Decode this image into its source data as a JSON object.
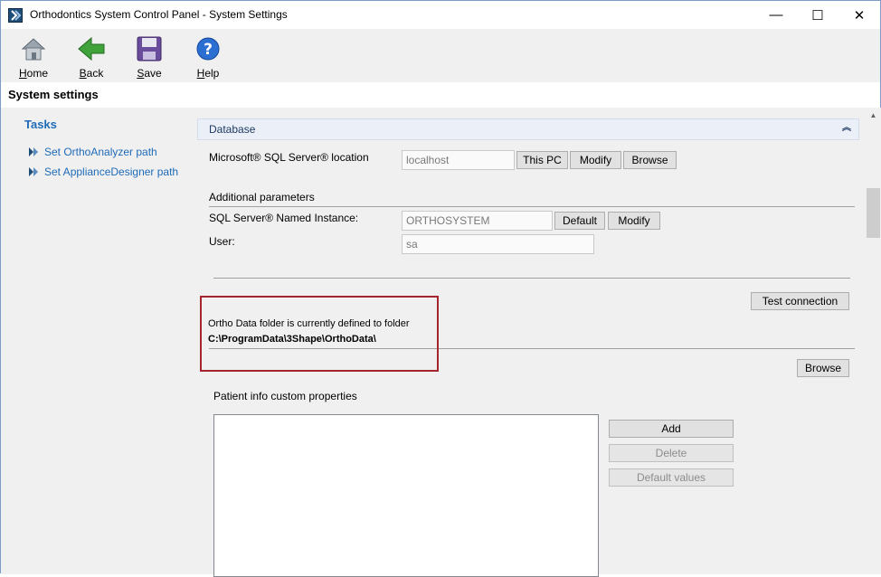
{
  "window": {
    "title": "Orthodontics System Control Panel - System Settings",
    "controls": {
      "minimize": "—",
      "maximize": "☐",
      "close": "✕"
    }
  },
  "toolbar": {
    "home": "Home",
    "back": "Back",
    "save": "Save",
    "help": "Help"
  },
  "page": {
    "title": "System settings"
  },
  "tasks": {
    "title": "Tasks",
    "items": [
      {
        "label": "Set OrthoAnalyzer path"
      },
      {
        "label": "Set ApplianceDesigner path"
      }
    ]
  },
  "database": {
    "section_title": "Database",
    "collapse_glyph": "︽",
    "sql_location_label": "Microsoft® SQL Server® location",
    "sql_location_value": "localhost",
    "this_pc": "This PC",
    "modify": "Modify",
    "browse": "Browse",
    "additional_params": "Additional parameters",
    "named_instance_label": "SQL Server® Named Instance:",
    "named_instance_value": "ORTHOSYSTEM",
    "default": "Default",
    "modify2": "Modify",
    "user_label": "User:",
    "user_value": "sa",
    "test_connection": "Test connection",
    "ortho_data_text": "Ortho Data folder is currently defined to folder",
    "ortho_data_path": "C:\\ProgramData\\3Shape\\OrthoData\\",
    "browse2": "Browse",
    "patient_info_label": "Patient info custom properties",
    "add": "Add",
    "delete": "Delete",
    "default_values": "Default values"
  },
  "colors": {
    "accent": "#1e6bb8",
    "highlight": "#a4262c"
  }
}
